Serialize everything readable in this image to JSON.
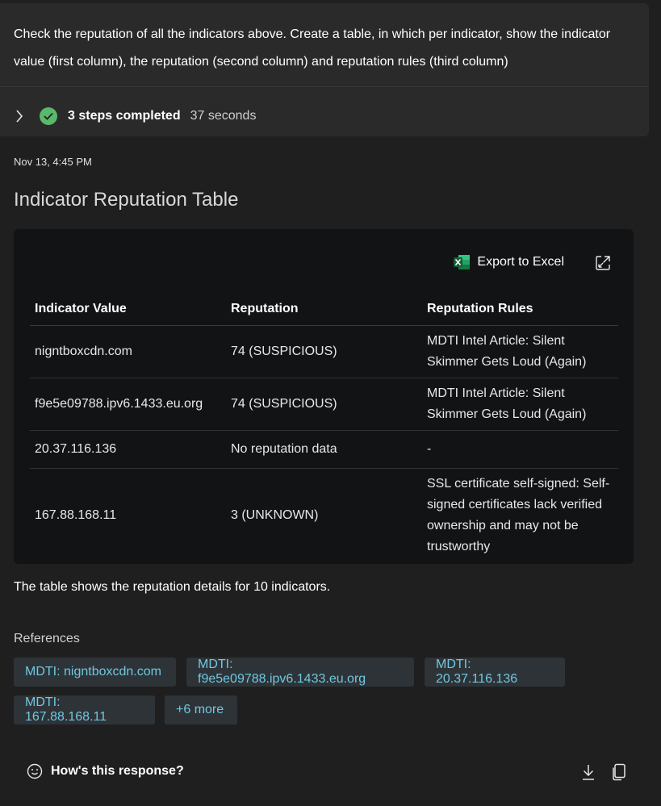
{
  "prompt": {
    "text": "Check the reputation of all the indicators above. Create a table, in which per indicator, show the indicator value (first column), the reputation (second column) and reputation rules (third column)"
  },
  "steps": {
    "label": "3 steps completed",
    "duration": "37 seconds"
  },
  "response": {
    "timestamp": "Nov 13, 4:45 PM",
    "heading": "Indicator Reputation Table",
    "export_label": "Export to Excel",
    "table": {
      "headers": [
        "Indicator Value",
        "Reputation",
        "Reputation Rules"
      ],
      "rows": [
        [
          "nigntboxcdn.com",
          "74 (SUSPICIOUS)",
          "MDTI Intel Article: Silent Skimmer Gets Loud (Again)"
        ],
        [
          "f9e5e09788.ipv6.1433.eu.org",
          "74 (SUSPICIOUS)",
          "MDTI Intel Article: Silent Skimmer Gets Loud (Again)"
        ],
        [
          "20.37.116.136",
          "No reputation data",
          "-"
        ],
        [
          "167.88.168.11",
          "3 (UNKNOWN)",
          "SSL certificate self-signed: Self-signed certificates lack verified ownership and may not be trustworthy"
        ]
      ]
    },
    "summary": "The table shows the reputation details for 10 indicators."
  },
  "references": {
    "title": "References",
    "chips": [
      "MDTI: nigntboxcdn.com",
      "MDTI: f9e5e09788.ipv6.1433.eu.org",
      "MDTI: 20.37.116.136",
      "MDTI: 167.88.168.11",
      "+6 more"
    ]
  },
  "footer": {
    "feedback_label": "How's this response?"
  },
  "colors": {
    "background": "#1f1f1f",
    "card": "#2a2a2a",
    "table_bg": "#121314",
    "success": "#5bb86b",
    "link": "#6fc8e0"
  },
  "icons": [
    "chevron-right-icon",
    "check-circle-icon",
    "excel-icon",
    "expand-icon",
    "smile-icon",
    "download-icon",
    "copy-icon"
  ]
}
